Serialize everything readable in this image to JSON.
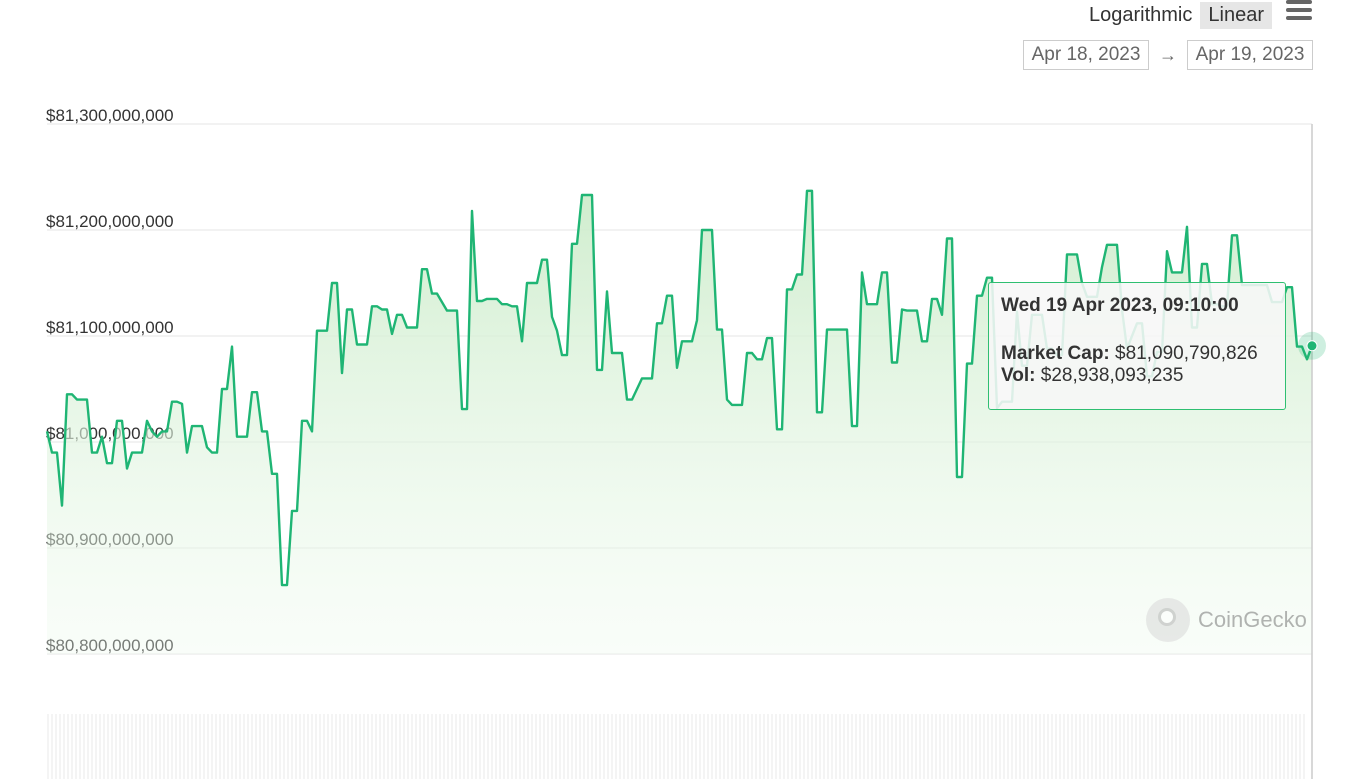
{
  "controls": {
    "scale_options": [
      "Logarithmic",
      "Linear"
    ],
    "active_scale": "Linear",
    "range_start": "Apr 18, 2023",
    "range_end": "Apr 19, 2023",
    "range_arrow": "→"
  },
  "watermark": {
    "text": "CoinGecko"
  },
  "tooltip": {
    "title": "Wed 19 Apr 2023, 09:10:00",
    "market_cap_label": "Market Cap:",
    "market_cap_value": "$81,090,790,826",
    "vol_label": "Vol:",
    "vol_value": "$28,938,093,235"
  },
  "colors": {
    "line": "#1fb574",
    "fill_top": "#d8f0d4",
    "grid": "#e6e6e6",
    "tooltip_border": "#2fbf71"
  },
  "chart_data": {
    "type": "area",
    "title": "",
    "xlabel": "",
    "ylabel": "",
    "ylim": [
      80800000000,
      81300000000
    ],
    "yticks": [
      80800000000,
      80900000000,
      81000000000,
      81100000000,
      81200000000,
      81300000000
    ],
    "ytick_labels": [
      "$80,800,000,000",
      "$80,900,000,000",
      "$81,000,000,000",
      "$81,100,000,000",
      "$81,200,000,000",
      "$81,300,000,000"
    ],
    "grid": true,
    "series": [
      {
        "values": [
          81010000000,
          80990000000,
          80990000000,
          80940000000,
          81045000000,
          81045000000,
          81040000000,
          81040000000,
          81040000000,
          80990000000,
          80990000000,
          81005000000,
          80980000000,
          80980000000,
          81020000000,
          81020000000,
          80975000000,
          80990000000,
          80990000000,
          80990000000,
          81020000000,
          81010000000,
          81005000000,
          81010000000,
          81010000000,
          81038000000,
          81038000000,
          81036000000,
          80990000000,
          81015000000,
          81015000000,
          81015000000,
          80995000000,
          80990000000,
          80990000000,
          81050000000,
          81050000000,
          81090000000,
          81005000000,
          81005000000,
          81005000000,
          81047000000,
          81047000000,
          81010000000,
          81010000000,
          80970000000,
          80970000000,
          80865000000,
          80865000000,
          80935000000,
          80935000000,
          81020000000,
          81020000000,
          81010000000,
          81105000000,
          81105000000,
          81105000000,
          81150000000,
          81150000000,
          81065000000,
          81125000000,
          81125000000,
          81092000000,
          81092000000,
          81092000000,
          81128000000,
          81128000000,
          81125000000,
          81125000000,
          81102000000,
          81120000000,
          81120000000,
          81108000000,
          81108000000,
          81108000000,
          81163000000,
          81163000000,
          81140000000,
          81140000000,
          81132000000,
          81124000000,
          81124000000,
          81124000000,
          81031000000,
          81031000000,
          81218000000,
          81133000000,
          81133000000,
          81135000000,
          81135000000,
          81135000000,
          81130000000,
          81130000000,
          81128000000,
          81128000000,
          81095000000,
          81150000000,
          81150000000,
          81150000000,
          81172000000,
          81172000000,
          81118000000,
          81105000000,
          81082000000,
          81082000000,
          81187000000,
          81187000000,
          81233000000,
          81233000000,
          81233000000,
          81068000000,
          81068000000,
          81142000000,
          81084000000,
          81084000000,
          81084000000,
          81040000000,
          81040000000,
          81050000000,
          81060000000,
          81060000000,
          81060000000,
          81112000000,
          81112000000,
          81138000000,
          81138000000,
          81070000000,
          81095000000,
          81095000000,
          81095000000,
          81115000000,
          81200000000,
          81200000000,
          81200000000,
          81106000000,
          81106000000,
          81040000000,
          81035000000,
          81035000000,
          81035000000,
          81084000000,
          81084000000,
          81078000000,
          81078000000,
          81098000000,
          81098000000,
          81012000000,
          81012000000,
          81144000000,
          81144000000,
          81158000000,
          81158000000,
          81237000000,
          81237000000,
          81028000000,
          81028000000,
          81106000000,
          81106000000,
          81106000000,
          81106000000,
          81106000000,
          81015000000,
          81015000000,
          81160000000,
          81130000000,
          81130000000,
          81130000000,
          81160000000,
          81160000000,
          81075000000,
          81075000000,
          81125000000,
          81124000000,
          81124000000,
          81124000000,
          81095000000,
          81095000000,
          81135000000,
          81135000000,
          81120000000,
          81192000000,
          81192000000,
          80967000000,
          80967000000,
          81074000000,
          81074000000,
          81138000000,
          81138000000,
          81155000000,
          81155000000,
          81032000000,
          81038000000,
          81038000000,
          81038000000,
          81123000000,
          81072000000,
          81072000000,
          81120000000,
          81120000000,
          81120000000,
          81088000000,
          81088000000,
          81082000000,
          81082000000,
          81177000000,
          81177000000,
          81177000000,
          81150000000,
          81137000000,
          81137000000,
          81137000000,
          81165000000,
          81186000000,
          81186000000,
          81186000000,
          81125000000,
          81088000000,
          81100000000,
          81112000000,
          81112000000,
          81062000000,
          81062000000,
          81085000000,
          81085000000,
          81180000000,
          81160000000,
          81160000000,
          81160000000,
          81203000000,
          81108000000,
          81108000000,
          81168000000,
          81168000000,
          81130000000,
          81130000000,
          81128000000,
          81128000000,
          81195000000,
          81195000000,
          81148000000,
          81148000000,
          81148000000,
          81148000000,
          81148000000,
          81148000000,
          81132000000,
          81132000000,
          81132000000,
          81146000000,
          81146000000,
          81090000000,
          81090000000,
          81078000000,
          81090790826
        ]
      }
    ],
    "highlighted_point": {
      "value": 81090790826
    }
  }
}
